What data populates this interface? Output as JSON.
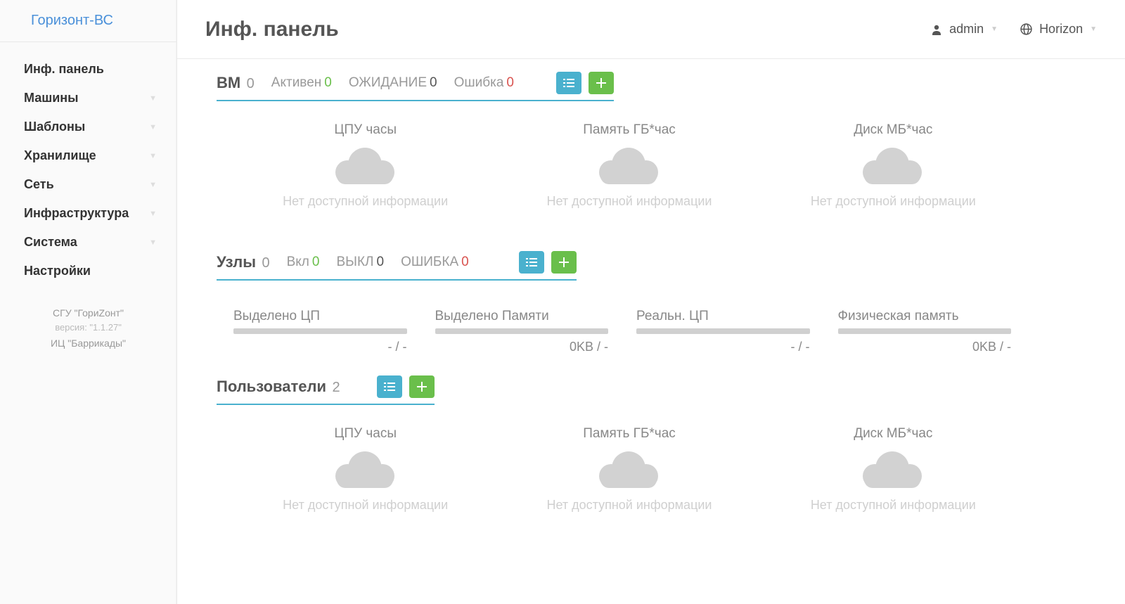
{
  "brand": "Горизонт-ВС",
  "page_title": "Инф. панель",
  "topbar": {
    "user": "admin",
    "zone": "Horizon"
  },
  "sidebar": {
    "items": [
      {
        "label": "Инф. панель",
        "expandable": false
      },
      {
        "label": "Машины",
        "expandable": true
      },
      {
        "label": "Шаблоны",
        "expandable": true
      },
      {
        "label": "Хранилище",
        "expandable": true
      },
      {
        "label": "Сеть",
        "expandable": true
      },
      {
        "label": "Инфраструктура",
        "expandable": true
      },
      {
        "label": "Система",
        "expandable": true
      },
      {
        "label": "Настройки",
        "expandable": false
      }
    ],
    "footer": {
      "line1": "СГУ \"ГориZонт\"",
      "line2": "версия: \"1.1.27\"",
      "line3": "ИЦ \"Баррикады\""
    }
  },
  "vm": {
    "title": "ВМ",
    "count": "0",
    "stats": [
      {
        "label": "Активен",
        "value": "0",
        "cls": "green"
      },
      {
        "label": "ОЖИДАНИЕ",
        "value": "0",
        "cls": "dark"
      },
      {
        "label": "Ошибка",
        "value": "0",
        "cls": "red"
      }
    ],
    "charts": [
      {
        "label": "ЦПУ часы",
        "noinfo": "Нет доступной информации"
      },
      {
        "label": "Память ГБ*час",
        "noinfo": "Нет доступной информации"
      },
      {
        "label": "Диск МБ*час",
        "noinfo": "Нет доступной информации"
      }
    ]
  },
  "nodes": {
    "title": "Узлы",
    "count": "0",
    "stats": [
      {
        "label": "Вкл",
        "value": "0",
        "cls": "green"
      },
      {
        "label": "ВЫКЛ",
        "value": "0",
        "cls": "dark"
      },
      {
        "label": "ОШИБКА",
        "value": "0",
        "cls": "red"
      }
    ],
    "bars": [
      {
        "label": "Выделено ЦП",
        "value": "- / -"
      },
      {
        "label": "Выделено Памяти",
        "value": "0KB / -"
      },
      {
        "label": "Реальн. ЦП",
        "value": "- / -"
      },
      {
        "label": "Физическая память",
        "value": "0KB / -"
      }
    ]
  },
  "users": {
    "title": "Пользователи",
    "count": "2",
    "charts": [
      {
        "label": "ЦПУ часы",
        "noinfo": "Нет доступной информации"
      },
      {
        "label": "Память ГБ*час",
        "noinfo": "Нет доступной информации"
      },
      {
        "label": "Диск МБ*час",
        "noinfo": "Нет доступной информации"
      }
    ]
  }
}
